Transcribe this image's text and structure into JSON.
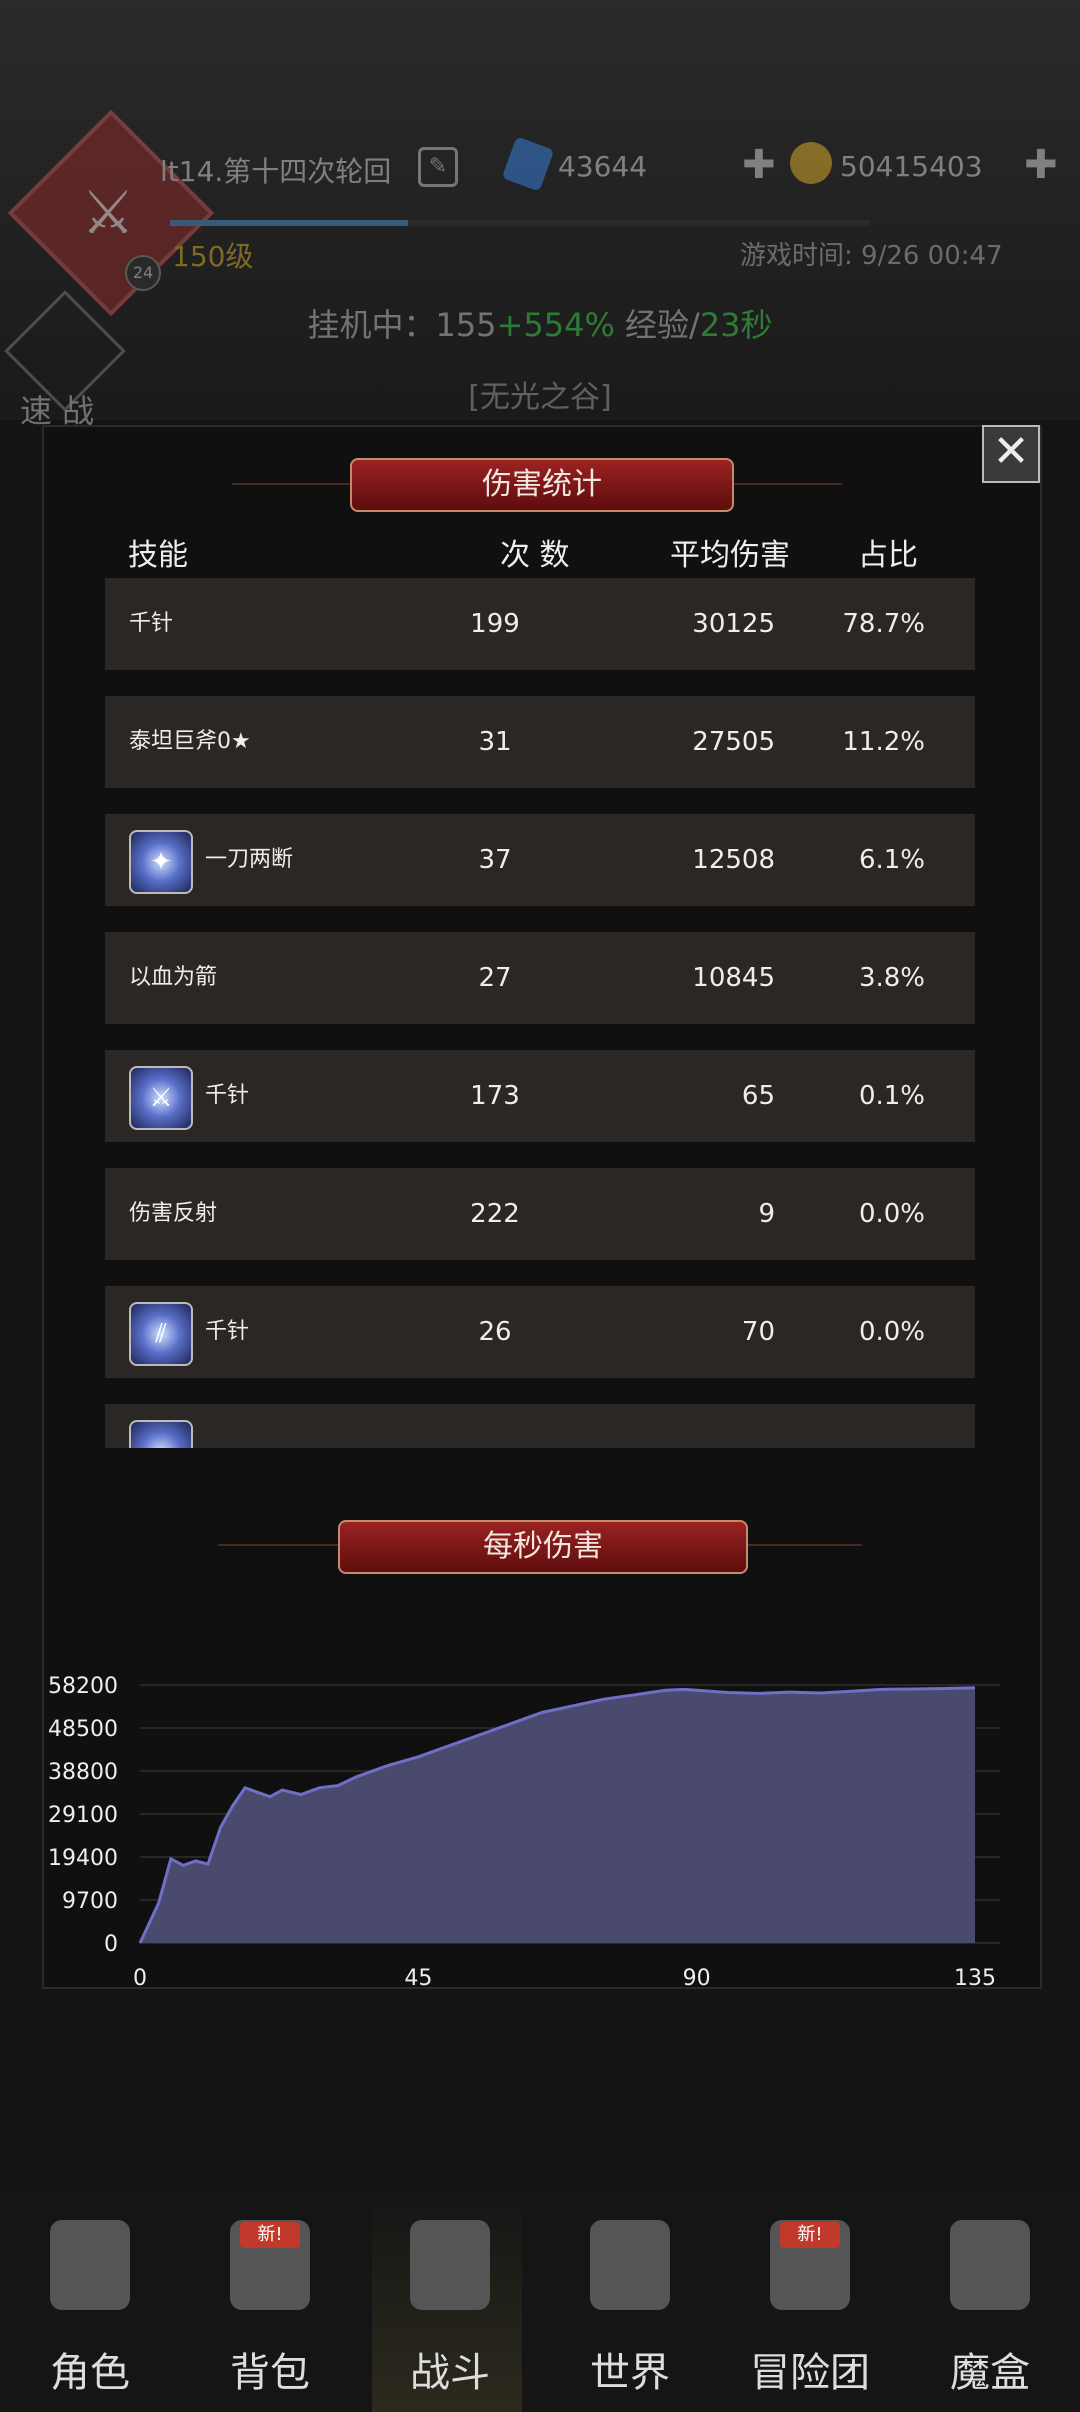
{
  "header": {
    "player_name": "lt14.第十四次轮回",
    "level_badge": "24",
    "level": "150级",
    "xp_fraction": 0.34,
    "gems": "43644",
    "gold": "50415403",
    "game_time": "游戏时间: 9/26 00:47",
    "afk": {
      "prefix": "挂机中：155",
      "bonus": "+554%",
      "mid": " 经验/",
      "time": "23秒"
    },
    "zone": "[无光之谷]",
    "quick_battle": "速 战",
    "plus": "✚"
  },
  "damage_panel": {
    "title": "伤害统计",
    "close_glyph": "✕",
    "columns": {
      "skill": "技能",
      "count": "次 数",
      "avg": "平均伤害",
      "share": "占比"
    },
    "rows": [
      {
        "name": "千针",
        "count": "199",
        "avg": "30125",
        "share": "78.7%",
        "icon": ""
      },
      {
        "name": "泰坦巨斧0★",
        "count": "31",
        "avg": "27505",
        "share": "11.2%",
        "icon": ""
      },
      {
        "name": "一刀两断",
        "count": "37",
        "avg": "12508",
        "share": "6.1%",
        "icon": "slash-skill-icon"
      },
      {
        "name": "以血为箭",
        "count": "27",
        "avg": "10845",
        "share": "3.8%",
        "icon": ""
      },
      {
        "name": "千针",
        "count": "173",
        "avg": "65",
        "share": "0.1%",
        "icon": "sword-skill-icon"
      },
      {
        "name": "伤害反射",
        "count": "222",
        "avg": "9",
        "share": "0.0%",
        "icon": ""
      },
      {
        "name": "千针",
        "count": "26",
        "avg": "70",
        "share": "0.0%",
        "icon": "claw-skill-icon"
      },
      {
        "name": "",
        "count": "",
        "avg": "",
        "share": "",
        "icon": "partial-skill-icon"
      }
    ]
  },
  "dps_panel": {
    "title": "每秒伤害"
  },
  "chart_data": {
    "type": "area",
    "title": "每秒伤害",
    "xlabel": "",
    "ylabel": "",
    "xlim": [
      0,
      135
    ],
    "ylim": [
      0,
      58200
    ],
    "xticks": [
      "0",
      "45",
      "90",
      "135"
    ],
    "yticks": [
      "0",
      "9700",
      "19400",
      "29100",
      "38800",
      "48500",
      "58200"
    ],
    "grid": true,
    "fill_color": "#4a4a6e",
    "line_color": "#6f6fc8",
    "series": [
      {
        "x": [
          0,
          3,
          5,
          7,
          9,
          11,
          13,
          15,
          17,
          19,
          21,
          23,
          26,
          29,
          32,
          35,
          40,
          45,
          50,
          55,
          60,
          65,
          70,
          75,
          80,
          85,
          88,
          90,
          95,
          100,
          105,
          110,
          115,
          120,
          125,
          130,
          135
        ],
        "y": [
          0,
          9000,
          19000,
          17500,
          18500,
          17800,
          26000,
          31000,
          35000,
          34000,
          33000,
          34500,
          33500,
          35000,
          35500,
          37500,
          40000,
          42000,
          44500,
          47000,
          49500,
          52000,
          53500,
          55000,
          56000,
          57000,
          57200,
          57000,
          56500,
          56300,
          56600,
          56400,
          56800,
          57200,
          57300,
          57400,
          57600
        ]
      }
    ]
  },
  "nav": {
    "items": [
      {
        "label": "角色",
        "new": ""
      },
      {
        "label": "背包",
        "new": "新!"
      },
      {
        "label": "战斗",
        "new": ""
      },
      {
        "label": "世界",
        "new": ""
      },
      {
        "label": "冒险团",
        "new": "新!"
      },
      {
        "label": "魔盒",
        "new": ""
      }
    ]
  }
}
